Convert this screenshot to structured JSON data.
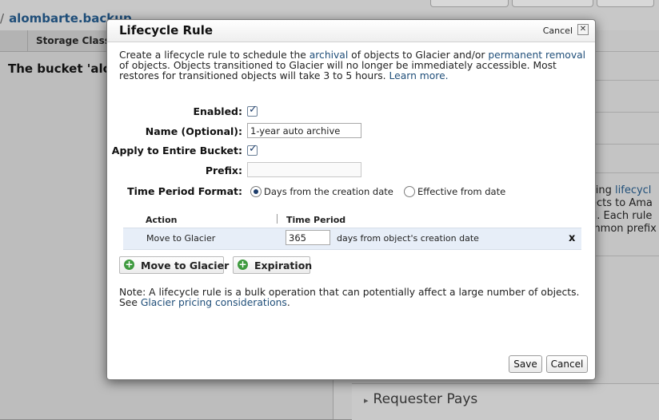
{
  "background": {
    "breadcrumb_bucket": "alombarte.backup",
    "column_header": "Storage Class",
    "bucket_message": "The bucket 'alon",
    "side_lines": [
      {
        "pre": "sing ",
        "link": "lifecycl"
      },
      {
        "pre": "ects to Ama",
        "link": ""
      },
      {
        "pre": "d. Each rule",
        "link": ""
      },
      {
        "pre": "mmon prefix",
        "link": ""
      }
    ],
    "requester_pays": "Requester Pays"
  },
  "dialog": {
    "title": "Lifecycle Rule",
    "cancel_top": "Cancel",
    "close_glyph": "✕",
    "intro": {
      "t1": "Create a lifecycle rule to schedule the ",
      "link1": "archival",
      "t2": " of objects to Glacier and/or ",
      "link2": "permanent removal",
      "t3": " of objects. Objects transitioned to Glacier will no longer be immediately accessible. Most restores for transitioned objects will take 3 to 5 hours. ",
      "link3": "Learn more."
    },
    "form": {
      "enabled_label": "Enabled:",
      "enabled_checked": true,
      "name_label": "Name (Optional):",
      "name_value": "1-year auto archive",
      "apply_label": "Apply to Entire Bucket:",
      "apply_checked": true,
      "prefix_label": "Prefix:",
      "prefix_value": "",
      "time_format_label": "Time Period Format:",
      "radio_days": "Days from the creation date",
      "radio_effective": "Effective from date",
      "selected": "days"
    },
    "table": {
      "headers": [
        "Action",
        "Time Period"
      ],
      "rows": [
        {
          "action": "Move to Glacier",
          "days": "365",
          "suffix": "days from object's creation date",
          "remove": "x"
        }
      ]
    },
    "add_buttons": [
      "Move to Glacier",
      "Expiration"
    ],
    "note": {
      "text": "Note: A lifecycle rule is a bulk operation that can potentially affect a large number of objects. See ",
      "link": "Glacier pricing considerations",
      "end": "."
    },
    "save": "Save",
    "cancel": "Cancel"
  }
}
